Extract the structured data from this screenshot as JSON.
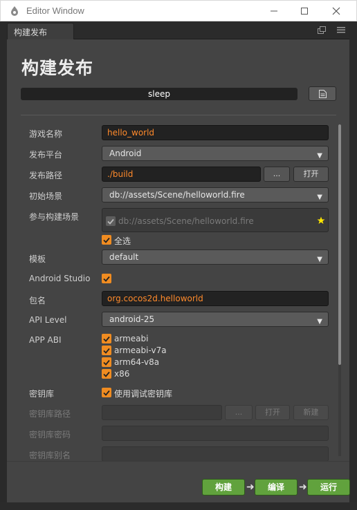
{
  "window": {
    "title": "Editor Window"
  },
  "tab": {
    "label": "构建发布"
  },
  "page": {
    "title": "构建发布"
  },
  "status": {
    "text": "sleep"
  },
  "form": {
    "game_name": {
      "label": "游戏名称",
      "value": "hello_world"
    },
    "platform": {
      "label": "发布平台",
      "value": "Android"
    },
    "build_path": {
      "label": "发布路径",
      "value": "./build",
      "browse": "...",
      "open": "打开"
    },
    "start_scene": {
      "label": "初始场景",
      "value": "db://assets/Scene/helloworld.fire"
    },
    "scenes": {
      "label": "参与构建场景",
      "item": "db://assets/Scene/helloworld.fire",
      "select_all": "全选"
    },
    "template": {
      "label": "模板",
      "value": "default"
    },
    "android_studio": {
      "label": "Android Studio",
      "checked": true
    },
    "package": {
      "label": "包名",
      "value": "org.cocos2d.helloworld"
    },
    "api_level": {
      "label": "API Level",
      "value": "android-25"
    },
    "app_abi": {
      "label": "APP ABI",
      "options": [
        "armeabi",
        "armeabi-v7a",
        "arm64-v8a",
        "x86"
      ]
    },
    "keystore": {
      "label": "密钥库",
      "use_debug": "使用调试密钥库"
    },
    "keystore_path": {
      "label": "密钥库路径",
      "browse": "...",
      "open": "打开",
      "new": "新建"
    },
    "keystore_password": {
      "label": "密钥库密码"
    },
    "keystore_alias": {
      "label": "密钥库别名"
    }
  },
  "actions": {
    "build": "构建",
    "compile": "编译",
    "run": "运行"
  },
  "colors": {
    "accent": "#f08c21",
    "green": "#61a23d",
    "panel": "#444444"
  }
}
